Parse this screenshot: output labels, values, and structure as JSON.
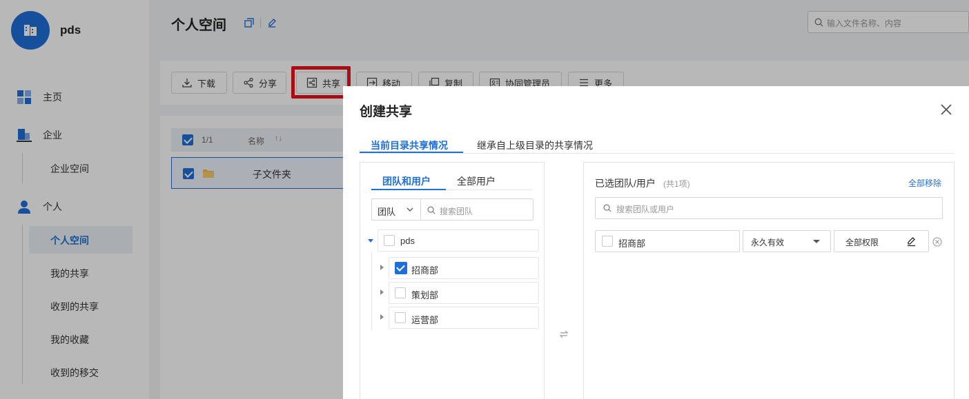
{
  "app": {
    "name": "pds"
  },
  "sidebar": {
    "items": [
      {
        "label": "主页"
      },
      {
        "label": "企业"
      },
      {
        "label": "企业空间"
      },
      {
        "label": "个人"
      },
      {
        "label": "个人空间"
      },
      {
        "label": "我的共享"
      },
      {
        "label": "收到的共享"
      },
      {
        "label": "我的收藏"
      },
      {
        "label": "收到的移交"
      }
    ]
  },
  "header": {
    "title": "个人空间",
    "search_placeholder": "输入文件名称、内容"
  },
  "toolbar": {
    "download": "下载",
    "share": "分享",
    "co_share": "共享",
    "move": "移动",
    "copy": "复制",
    "collab_admin": "协同管理员",
    "more": "更多"
  },
  "file_list": {
    "count": "1/1",
    "name_header": "名称",
    "rows": [
      {
        "name": "子文件夹"
      }
    ]
  },
  "dialog": {
    "title": "创建共享",
    "tabs": [
      "当前目录共享情况",
      "继承自上级目录的共享情况"
    ],
    "left": {
      "tabs": [
        "团队和用户",
        "全部用户"
      ],
      "filter_type": "团队",
      "search_placeholder": "搜索团队",
      "root": "pds",
      "nodes": [
        {
          "label": "招商部",
          "checked": true
        },
        {
          "label": "策划部",
          "checked": false
        },
        {
          "label": "运营部",
          "checked": false
        }
      ]
    },
    "right": {
      "title": "已选团队/用户",
      "count": "(共1项)",
      "remove_all": "全部移除",
      "search_placeholder": "搜索团队或用户",
      "selected": [
        {
          "name": "招商部",
          "expiry": "永久有效",
          "permission": "全部权限"
        }
      ]
    }
  },
  "colors": {
    "accent": "#1f6fd8",
    "highlight": "#e8141e"
  }
}
